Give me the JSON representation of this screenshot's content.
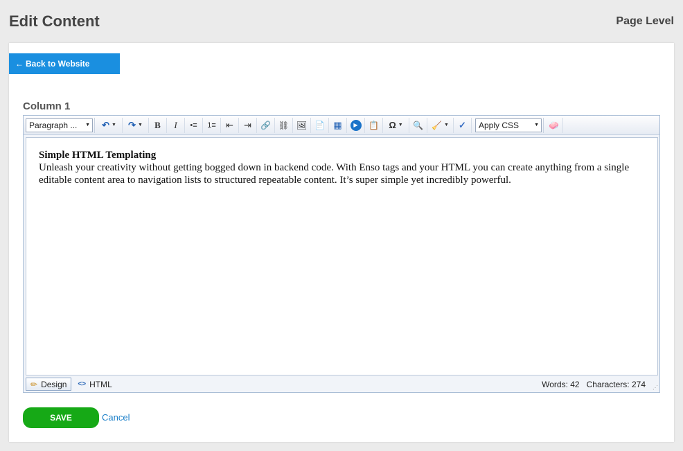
{
  "header": {
    "title": "Edit Content",
    "level": "Page Level"
  },
  "back_button": {
    "arrow": "←",
    "label": "Back to Website"
  },
  "column": {
    "label": "Column 1"
  },
  "toolbar": {
    "format_select": "Paragraph ...",
    "css_select": "Apply CSS",
    "icons": {
      "undo": "↶",
      "redo": "↷",
      "bold": "B",
      "italic": "I",
      "bulleted_list": "•≡",
      "numbered_list": "1≡",
      "outdent": "⇤",
      "indent": "⇥",
      "link": "🔗",
      "unlink": "⛓",
      "image": "🖼",
      "document": "📄",
      "table": "▦",
      "media": "▶",
      "paste_html": "📋",
      "special_char": "Ω",
      "find": "🔍",
      "format_stripper": "🧹",
      "spell_check": "✓",
      "cleanup": "🧼"
    },
    "colors": {
      "media": "#1a73c9",
      "link": "#2f8f2f",
      "spell": "#3a6fc4"
    }
  },
  "content": {
    "heading": "Simple HTML Templating",
    "body": "Unleash your creativity without getting bogged down in backend code. With Enso tags and your HTML you can create anything from a single editable content area to navigation lists to structured repeatable content. It’s super simple yet incredibly powerful."
  },
  "statusbar": {
    "design_label": "Design",
    "design_icon": "✏",
    "html_label": "HTML",
    "html_icon": "<>",
    "words": "Words: 42",
    "characters": "Characters: 274",
    "grip": "⋰"
  },
  "actions": {
    "save_label": "SAVE",
    "cancel_label": "Cancel"
  }
}
